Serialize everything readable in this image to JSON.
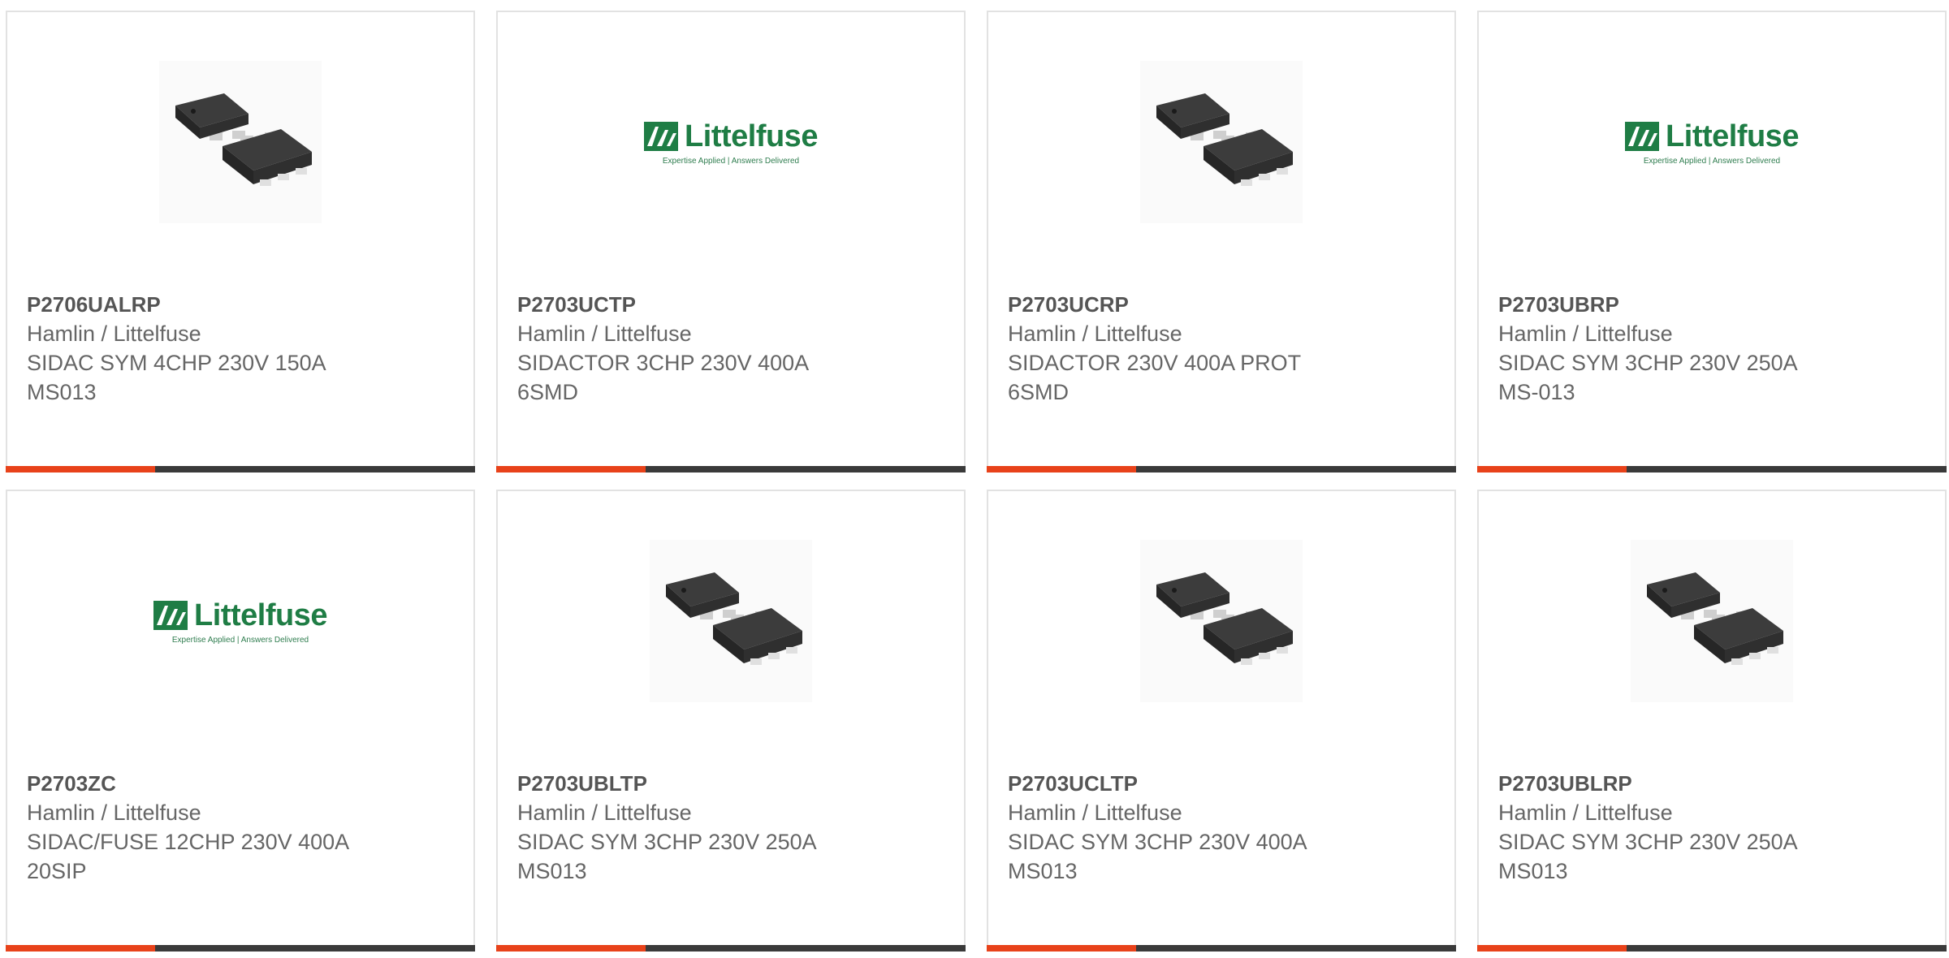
{
  "colors": {
    "accent": "#e8421a",
    "bar": "#3a3a3a",
    "brand_green": "#1f7d45"
  },
  "products": [
    {
      "part_number": "P2706UALRP",
      "manufacturer": "Hamlin / Littelfuse",
      "desc1": "SIDAC SYM 4CHP 230V 150A",
      "desc2": "MS013",
      "image": "chip-package-icon"
    },
    {
      "part_number": "P2703UCTP",
      "manufacturer": "Hamlin / Littelfuse",
      "desc1": "SIDACTOR 3CHP 230V 400A",
      "desc2": "6SMD",
      "image": "littelfuse-logo"
    },
    {
      "part_number": "P2703UCRP",
      "manufacturer": "Hamlin / Littelfuse",
      "desc1": "SIDACTOR 230V 400A PROT",
      "desc2": "6SMD",
      "image": "chip-package-icon"
    },
    {
      "part_number": "P2703UBRP",
      "manufacturer": "Hamlin / Littelfuse",
      "desc1": "SIDAC SYM 3CHP 230V 250A",
      "desc2": "MS-013",
      "image": "littelfuse-logo"
    },
    {
      "part_number": "P2703ZC",
      "manufacturer": "Hamlin / Littelfuse",
      "desc1": "SIDAC/FUSE 12CHP 230V 400A",
      "desc2": "20SIP",
      "image": "littelfuse-logo"
    },
    {
      "part_number": "P2703UBLTP",
      "manufacturer": "Hamlin / Littelfuse",
      "desc1": "SIDAC SYM 3CHP 230V 250A",
      "desc2": "MS013",
      "image": "chip-package-icon"
    },
    {
      "part_number": "P2703UCLTP",
      "manufacturer": "Hamlin / Littelfuse",
      "desc1": "SIDAC SYM 3CHP 230V 400A",
      "desc2": "MS013",
      "image": "chip-package-icon"
    },
    {
      "part_number": "P2703UBLRP",
      "manufacturer": "Hamlin / Littelfuse",
      "desc1": "SIDAC SYM 3CHP 230V 250A",
      "desc2": "MS013",
      "image": "chip-package-icon"
    }
  ],
  "logo": {
    "brand": "Littelfuse",
    "tagline": "Expertise Applied | Answers Delivered"
  }
}
